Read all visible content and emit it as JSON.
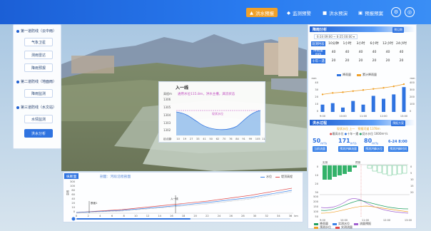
{
  "header": {
    "tabs": [
      {
        "label": "洪水预报",
        "icon": "flood-icon",
        "active": true
      },
      {
        "label": "监测预警",
        "icon": "alert-icon",
        "active": false
      },
      {
        "label": "洪水预演",
        "icon": "video-icon",
        "active": false
      },
      {
        "label": "预报预案",
        "icon": "document-icon",
        "active": false
      }
    ],
    "icon_labels": [
      "⚙",
      "◎"
    ]
  },
  "left_panel": {
    "sections": [
      {
        "title": "第一道防线（云中雨）",
        "items": [
          "气象卫星",
          "测雨雷达",
          "降雨预报"
        ]
      },
      {
        "title": "第二道防线（地面雨）",
        "items": [
          "降雨监测"
        ]
      },
      {
        "title": "第三道防线（水文站）",
        "items": [
          "水情监测",
          "洪水分析"
        ]
      }
    ],
    "active_item": "洪水分析"
  },
  "cross_section": {
    "title": "入一线",
    "info": "通用水位115.8m，洪水主槽，满流状态",
    "y_label": "高程m",
    "y_ticks": [
      "1306",
      "1305",
      "1304",
      "1303",
      "1302"
    ],
    "water_label": "现状水位",
    "x_ticks": [
      "起点距",
      "2",
      "10",
      "19",
      "27",
      "33",
      "41",
      "50",
      "62",
      "70",
      "76",
      "84",
      "91",
      "99",
      "105",
      "115"
    ]
  },
  "profile": {
    "tabs": [
      "纵断面",
      "剖面：河段沿程剖面"
    ],
    "legend": [
      "水位",
      "堤顶高程"
    ],
    "y_label": "高程",
    "y_ticks": [
      "300",
      "100",
      "80",
      "60",
      "40",
      "20",
      "10",
      "0"
    ],
    "x_ticks": [
      "0",
      "2",
      "4",
      "6",
      "8",
      "10",
      "12",
      "14",
      "16",
      "18",
      "20",
      "22",
      "24",
      "26",
      "28",
      "30",
      "32",
      "34",
      "36"
    ],
    "x_unit": "km",
    "annotations": [
      "断面1",
      "入一线"
    ]
  },
  "rain_analysis": {
    "title": "降雨分析",
    "tag": "预见期",
    "date_from": "6-24 09:00",
    "date_to": "6-25 00:00",
    "columns": [
      "观测时段",
      "10分钟",
      "1小时",
      "3小时",
      "6小时",
      "12小时",
      "24小时"
    ],
    "rows": [
      {
        "label": "降雨量mm",
        "values": [
          "40",
          "40",
          "40",
          "40",
          "40",
          "40"
        ]
      },
      {
        "label": "十年一遇",
        "values": [
          "20",
          "20",
          "20",
          "20",
          "20",
          "20"
        ]
      }
    ]
  },
  "rain_chart": {
    "legend": [
      "降雨量",
      "累计降雨量"
    ],
    "y_left_label": "mm",
    "y_right_label": "mm",
    "y_left_ticks": [
      "40",
      "30",
      "20",
      "10",
      "0"
    ],
    "y_right_ticks": [
      "400",
      "300",
      "200",
      "100",
      "0"
    ],
    "x_ticks": [
      "9:00",
      "10:00",
      "11:00",
      "12:00",
      "13:00"
    ]
  },
  "chart_data": [
    {
      "type": "bar",
      "categories": [
        "9:00",
        "9:30",
        "10:00",
        "10:30",
        "11:00",
        "11:30",
        "12:00",
        "12:30",
        "13:00"
      ],
      "series": [
        {
          "name": "降雨量",
          "values": [
            10,
            12,
            6,
            15,
            10,
            22,
            18,
            24,
            34
          ]
        },
        {
          "name": "累计降雨量",
          "values": [
            240,
            260,
            270,
            285,
            300,
            315,
            330,
            350,
            380
          ]
        }
      ],
      "ylim": [
        0,
        40
      ]
    }
  ],
  "flood_forecast": {
    "title": "洪水过程",
    "tag": "预报方案",
    "meta": [
      "现状水位 上一",
      "预报河道 1378m"
    ],
    "meta2": [
      "最高水位",
      "十年一遇",
      "设计水位",
      "1600m³/s"
    ],
    "stats": [
      {
        "value": "50",
        "unit": "m³/s",
        "label": "当前流量"
      },
      {
        "value": "171",
        "unit": "m³/s",
        "label": "预测洪峰流量"
      },
      {
        "value": "80",
        "unit": "m³/s",
        "label": "预测洪峰水位"
      },
      {
        "value": "6-24 8:00",
        "unit": "",
        "label": "预测洪峰时间"
      }
    ]
  },
  "flood_chart": {
    "y_left_ticks": [
      "0",
      "10",
      "20",
      "30"
    ],
    "y_right_ticks": [
      "0",
      "5",
      "10",
      "15",
      "20"
    ],
    "y_left2_ticks": [
      "500",
      "200",
      "150",
      "100",
      "50"
    ],
    "x_ticks": [
      "9:00",
      "10:00",
      "11:00",
      "12:00",
      "13:00"
    ],
    "legend": [
      "降雨量",
      "实测水位",
      "流量预报",
      "预测水位",
      "实测流量"
    ]
  }
}
